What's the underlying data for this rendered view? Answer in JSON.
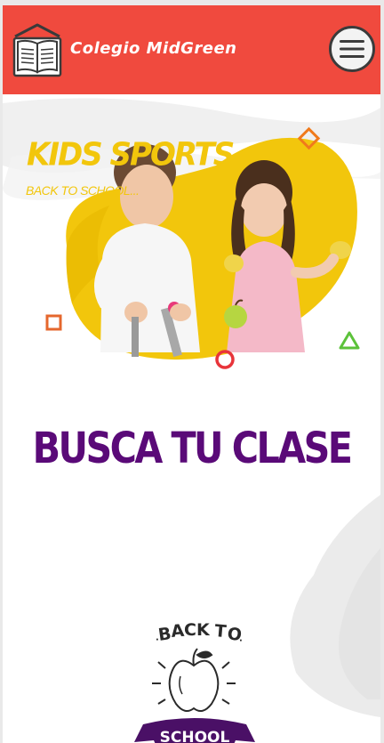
{
  "header": {
    "brand": "Colegio MidGreen",
    "logo_icon": "open-book-icon",
    "menu_icon": "hamburger-menu-icon",
    "background_color": "#f04a3e"
  },
  "hero": {
    "title": "KIDS SPORTS",
    "subtitle": "BACK TO SCHOOL...",
    "accent_color": "#f2c60c"
  },
  "main": {
    "headline": "BUSCA TU CLASE",
    "headline_color": "#5a0a78"
  },
  "badge": {
    "top_text": "BACK TO",
    "bottom_text": "SCHOOL",
    "icon": "apple-icon"
  }
}
